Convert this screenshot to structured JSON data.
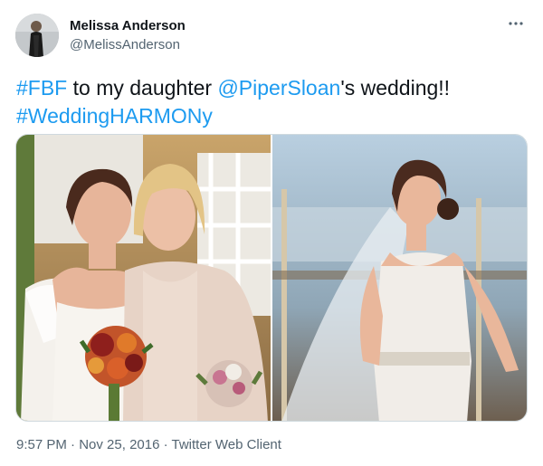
{
  "author": {
    "name": "Melissa Anderson",
    "handle": "@MelissAnderson"
  },
  "tweet": {
    "segments": [
      {
        "text": "#FBF",
        "type": "link"
      },
      {
        "text": " to my daughter ",
        "type": "text"
      },
      {
        "text": "@PiperSloan",
        "type": "link"
      },
      {
        "text": "'s wedding!!",
        "type": "text"
      }
    ],
    "hashtag_line": "#WeddingHARMONy"
  },
  "media": [
    {
      "icon": "wedding-photo-bride-and-mother"
    },
    {
      "icon": "wedding-photo-bride-portrait"
    }
  ],
  "meta": {
    "time": "9:57 PM",
    "separator1": " · ",
    "date": "Nov 25, 2016",
    "separator2": " · ",
    "client": "Twitter Web Client"
  },
  "colors": {
    "link": "#1d9bf0",
    "secondary_text": "#536471"
  }
}
